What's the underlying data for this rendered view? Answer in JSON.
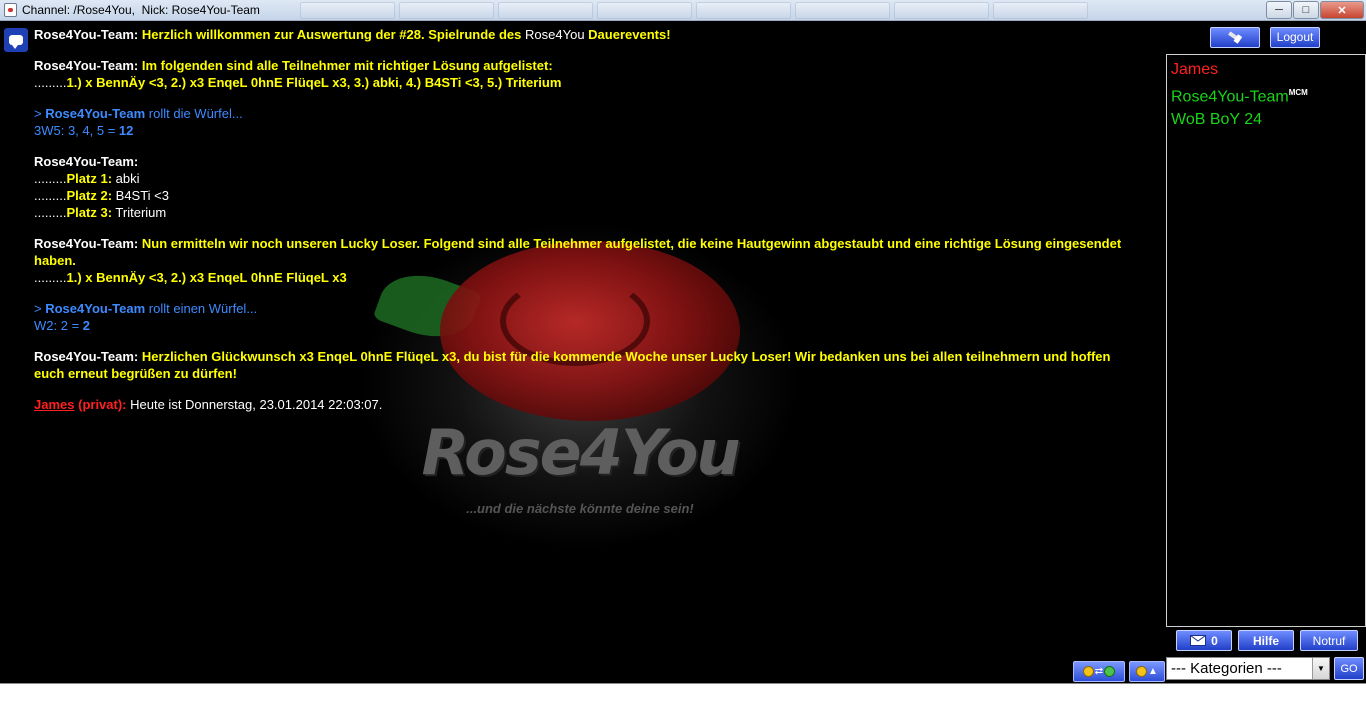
{
  "window": {
    "title": "Channel: /Rose4You,  Nick: Rose4You-Team",
    "btn_minimize": "─",
    "btn_maximize": "□",
    "btn_close": "✕"
  },
  "watermark": {
    "brand": "Rose4You",
    "slogan": "...und die nächste könnte deine sein!"
  },
  "messages": [
    {
      "sender": "Rose4You-Team:",
      "t1": "Herzlich willkommen zur Auswertung der #28. Spielrunde des",
      "t2": "Rose4You",
      "t3": "Dauerevents!"
    },
    {
      "sender": "Rose4You-Team:",
      "t1": "Im folgenden sind alle Teilnehmer mit richtiger Lösung aufgelistet:",
      "dots": ".........",
      "t2": "1.) x BennÄy <3, 2.) x3 EnqeL 0hnE FlüqeL x3, 3.) abki, 4.) B4STi <3, 5.) Triterium"
    },
    {
      "prefix": ">",
      "sender": "Rose4You-Team",
      "action": "rollt die Würfel...",
      "result_label": "3W5: 3, 4, 5 =",
      "result_value": "12"
    },
    {
      "sender": "Rose4You-Team:",
      "places": [
        {
          "dots": ".........",
          "label": "Platz 1:",
          "name": "abki"
        },
        {
          "dots": ".........",
          "label": "Platz 2:",
          "name": "B4STi <3"
        },
        {
          "dots": ".........",
          "label": "Platz 3:",
          "name": "Triterium"
        }
      ]
    },
    {
      "sender": "Rose4You-Team:",
      "t1": "Nun ermitteln wir noch unseren Lucky Loser. Folgend sind alle Teilnehmer aufgelistet, die keine Hautgewinn abgestaubt und eine richtige Lösung eingesendet haben.",
      "dots": ".........",
      "t2": "1.) x BennÄy <3, 2.) x3 EnqeL 0hnE FlüqeL x3"
    },
    {
      "prefix": ">",
      "sender": "Rose4You-Team",
      "action": "rollt einen Würfel...",
      "result_label": "W2: 2 =",
      "result_value": "2"
    },
    {
      "sender": "Rose4You-Team:",
      "t1": "Herzlichen Glückwunsch x3 EnqeL 0hnE FlüqeL x3, du bist für die kommende Woche unser Lucky Loser! Wir bedanken uns bei allen teilnehmern und hoffen euch erneut begrüßen zu dürfen!"
    },
    {
      "sender": "James",
      "private": "(privat):",
      "t1": "Heute ist Donnerstag, 23.01.2014 22:03:07."
    }
  ],
  "sidebar": {
    "logout_label": "Logout",
    "users": [
      {
        "name": "James",
        "color": "#ff2020",
        "badge": ""
      },
      {
        "name": "Rose4You-Team",
        "color": "#19d419",
        "badge": "MCM"
      },
      {
        "name": "WoB BoY 24",
        "color": "#19d419",
        "badge": ""
      }
    ],
    "mail_count": "0",
    "help_label": "Hilfe",
    "emergency_label": "Notruf",
    "category_value": "--- Kategorien ---",
    "go_label": "GO"
  },
  "input": {
    "placeholder": ""
  },
  "colors": {
    "accent_blue": "#2d4fd6",
    "system_yellow": "#ffff00",
    "roll_blue": "#3d8bff",
    "private_red": "#ff2020",
    "user_green": "#19d419"
  }
}
